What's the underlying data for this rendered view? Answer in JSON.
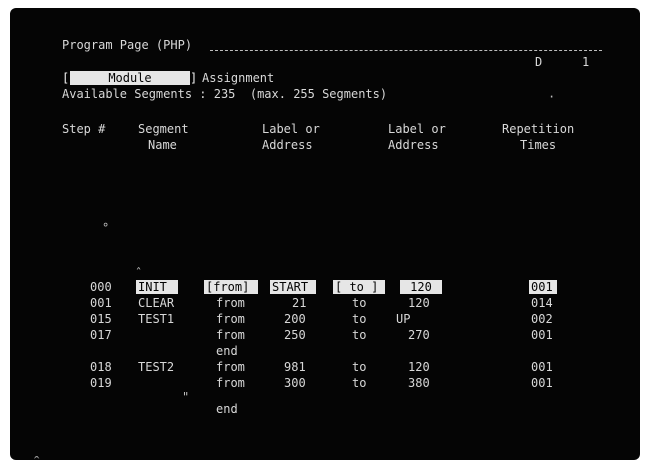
{
  "header": {
    "title": "Program Page (PHP)",
    "page_indicator_a": "D",
    "page_indicator_b": "1"
  },
  "mode": {
    "bracket_open": "[",
    "selected": "Module",
    "bracket_close": "]",
    "assignment_label": "Assignment"
  },
  "available": {
    "text": "Available Segments : 235  (max. 255 Segments)"
  },
  "columns": {
    "step": "Step #",
    "segment_line1": "Segment",
    "segment_line2": "Name",
    "label1_line1": "Label or",
    "label1_line2": "Address",
    "label2_line1": "Label or",
    "label2_line2": "Address",
    "rep_line1": "Repetition",
    "rep_line2": "Times"
  },
  "rows": [
    {
      "step": "000",
      "segment": "INIT",
      "from": "[from]",
      "label1": "START",
      "to": "[ to ]",
      "label2": "120",
      "reps": "001"
    },
    {
      "step": "001",
      "segment": "CLEAR",
      "from": "from",
      "label1": "21",
      "to": "to",
      "label2": "120",
      "reps": "014"
    },
    {
      "step": "015",
      "segment": "TEST1",
      "from": "from",
      "label1": "200",
      "to": "to",
      "label2": "UP",
      "reps": "002"
    },
    {
      "step": "017",
      "segment": "",
      "from": "from",
      "label1": "250",
      "to": "to",
      "label2": "270",
      "reps": "001"
    },
    {
      "step": "",
      "segment": "",
      "from": "end",
      "label1": "",
      "to": "",
      "label2": "",
      "reps": ""
    },
    {
      "step": "018",
      "segment": "TEST2",
      "from": "from",
      "label1": "981",
      "to": "to",
      "label2": "120",
      "reps": "001"
    },
    {
      "step": "019",
      "segment": "",
      "from": "from",
      "label1": "300",
      "to": "to",
      "label2": "380",
      "reps": "001"
    },
    {
      "step": "",
      "segment": "",
      "from": "end",
      "label1": "",
      "to": "",
      "label2": "",
      "reps": ""
    }
  ]
}
